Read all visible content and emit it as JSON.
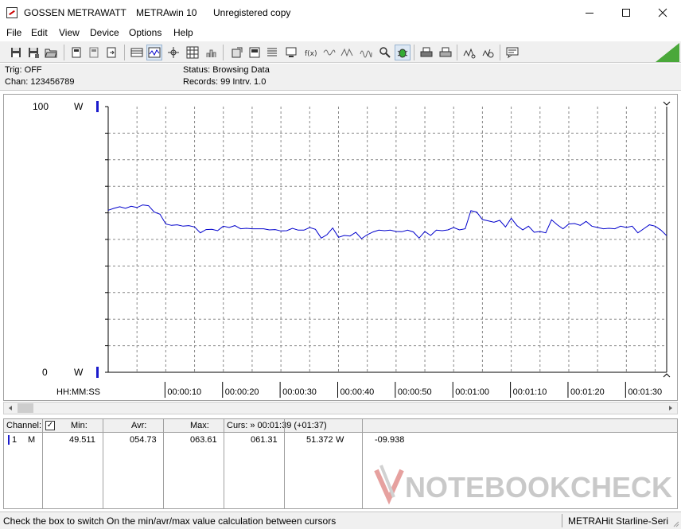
{
  "window": {
    "title_parts": [
      "GOSSEN METRAWATT",
      "METRAwin 10",
      "Unregistered copy"
    ],
    "controls": [
      "minimize",
      "maximize",
      "close"
    ]
  },
  "menu": [
    "File",
    "Edit",
    "View",
    "Device",
    "Options",
    "Help"
  ],
  "toolbar_icons": [
    "save-icon",
    "save-as-icon",
    "open-folder-icon",
    "device-icon",
    "device-read-icon",
    "device-send-icon",
    "table-view-icon",
    "graph-view-icon",
    "cursor-icon",
    "grid-icon",
    "histogram-icon",
    "export-icon",
    "print-preview-icon",
    "list-icon",
    "monitor-icon",
    "function-icon",
    "wave-icon",
    "wave-icon",
    "wave-icon",
    "zoom-icon",
    "bug-icon",
    "print-icon",
    "printer-icon",
    "measure-icon",
    "measure-icon",
    "comment-icon"
  ],
  "status": {
    "trig": "Trig: OFF",
    "chan": "Chan:  123456789",
    "status": "Status:   Browsing Data",
    "records": "Records: 99   Intrv. 1.0"
  },
  "chart_data": {
    "type": "line",
    "ylim": [
      0,
      100
    ],
    "y_top_label": "100",
    "y_bottom_label": "0",
    "y_unit": "W",
    "xlabel": "HH:MM:SS",
    "x_ticks": [
      "00:00:10",
      "00:00:20",
      "00:00:30",
      "00:00:40",
      "00:00:50",
      "00:01:00",
      "00:01:10",
      "00:01:20",
      "00:01:30"
    ],
    "xlim": [
      0,
      97
    ],
    "grid": true,
    "series": [
      {
        "color": "#0000cc",
        "x": [
          0,
          1,
          2,
          3,
          4,
          5,
          6,
          7,
          8,
          9,
          10,
          11,
          12,
          13,
          14,
          15,
          16,
          17,
          18,
          19,
          20,
          21,
          22,
          23,
          24,
          25,
          26,
          27,
          28,
          29,
          30,
          31,
          32,
          33,
          34,
          35,
          36,
          37,
          38,
          39,
          40,
          41,
          42,
          43,
          44,
          45,
          46,
          47,
          48,
          49,
          50,
          51,
          52,
          53,
          54,
          55,
          56,
          57,
          58,
          59,
          60,
          61,
          62,
          63,
          64,
          65,
          66,
          67,
          68,
          69,
          70,
          71,
          72,
          73,
          74,
          75,
          76,
          77,
          78,
          79,
          80,
          81,
          82,
          83,
          84,
          85,
          86,
          87,
          88,
          89,
          90,
          91,
          92,
          93,
          94,
          95,
          96,
          97
        ],
        "values": [
          61.0,
          61.7,
          62.3,
          61.7,
          62.5,
          62.0,
          63.0,
          62.7,
          60.3,
          59.5,
          55.8,
          55.3,
          55.5,
          55.0,
          55.2,
          54.7,
          52.5,
          53.7,
          53.8,
          53.3,
          55.0,
          54.5,
          55.2,
          54.0,
          54.2,
          54.0,
          54.0,
          54.0,
          53.6,
          53.7,
          53.2,
          53.3,
          54.2,
          53.5,
          53.5,
          54.5,
          53.8,
          50.5,
          51.8,
          54.3,
          50.8,
          51.5,
          51.3,
          52.7,
          50.3,
          51.8,
          52.8,
          53.5,
          53.3,
          53.5,
          53.0,
          52.9,
          53.5,
          52.8,
          50.5,
          53.0,
          51.5,
          53.5,
          53.3,
          53.6,
          54.5,
          53.6,
          54.0,
          60.8,
          60.3,
          57.5,
          57.0,
          56.5,
          57.2,
          54.7,
          58.0,
          55.2,
          53.6,
          55.0,
          52.7,
          53.0,
          52.5,
          57.4,
          55.5,
          54.0,
          55.8,
          56.0,
          55.3,
          56.8,
          55.0,
          54.5,
          54.0,
          54.2,
          54.0,
          55.0,
          54.5,
          55.0,
          52.5,
          54.0,
          55.5,
          55.0,
          53.5,
          51.4
        ]
      }
    ]
  },
  "channel_table": {
    "headers": {
      "channel": "Channel:",
      "min": "Min:",
      "avr": "Avr:",
      "max": "Max:",
      "curs": "Curs: » 00:01:39 (+01:37)"
    },
    "row": {
      "num": "1",
      "mode": "M",
      "min": "49.511",
      "avr": "054.73",
      "max": "063.61",
      "curs": "061.31",
      "val": "51.372",
      "unit": "W",
      "delta": "-09.938"
    }
  },
  "watermark": "NOTEBOOKCHECK",
  "statusbar": {
    "left": "Check the box to switch On the min/avr/max value calculation between cursors",
    "right": "METRAHit Starline-Seri"
  }
}
